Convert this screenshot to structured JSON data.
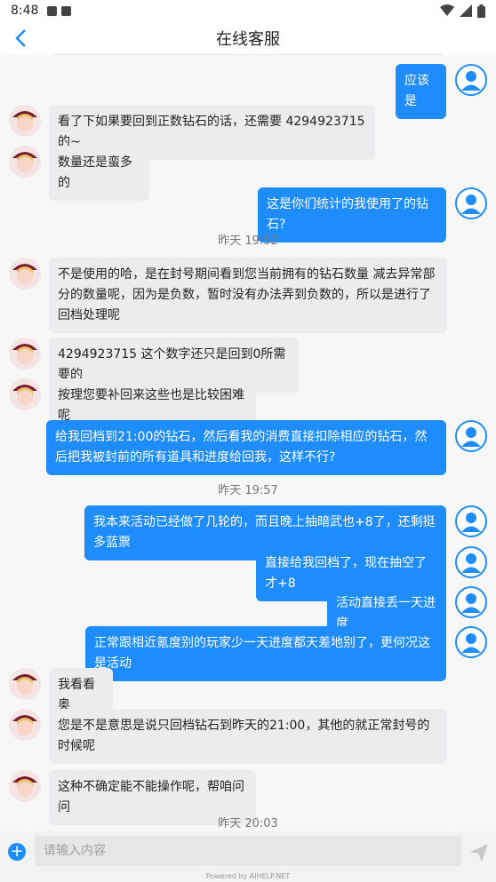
{
  "status_bar": {
    "time": "8:48",
    "icons": [
      "image-icon",
      "text-a-icon",
      "wifi-icon",
      "signal-icon",
      "battery-icon"
    ]
  },
  "header": {
    "title": "在线客服",
    "back_icon": "chevron-left-icon"
  },
  "colors": {
    "accent": "#1e8cfa",
    "bubble_left": "#ececee",
    "page_bg": "#f7f7f7"
  },
  "messages": [
    {
      "side": "right",
      "text": "应该是"
    },
    {
      "side": "left",
      "text": "看了下如果要回到正数钻石的话，还需要 4294923715 的~"
    },
    {
      "side": "left",
      "text": "数量还是蛮多的"
    },
    {
      "side": "right",
      "text": "这是你们统计的我使用了的钻石?"
    },
    {
      "type": "time",
      "text": "昨天 19:52"
    },
    {
      "side": "left",
      "text": "不是使用的哈，是在封号期间看到您当前拥有的钻石数量 减去异常部分的数量呢，因为是负数，暂时没有办法弄到负数的，所以是进行了回档处理呢"
    },
    {
      "side": "left",
      "text": "4294923715 这个数字还只是回到0所需要的"
    },
    {
      "side": "left",
      "text": "按理您要补回来这些也是比较困难呢"
    },
    {
      "side": "right",
      "text": "给我回档到21:00的钻石，然后看我的消费直接扣除相应的钻石，然后把我被封前的所有道具和进度给回我，这样不行?"
    },
    {
      "type": "time",
      "text": "昨天 19:57"
    },
    {
      "side": "right",
      "text": "我本来活动已经做了几轮的，而且晚上抽暗武也+8了，还剩挺多蓝票"
    },
    {
      "side": "right",
      "text": "直接给我回档了，现在抽空了才+8"
    },
    {
      "side": "right",
      "text": "活动直接丢一天进度"
    },
    {
      "side": "right",
      "text": "正常跟相近氪度别的玩家少一天进度都天差地别了，更何况这是活动"
    },
    {
      "side": "left",
      "text": "我看看奥"
    },
    {
      "side": "left",
      "text": "您是不是意思是说只回档钻石到昨天的21:00，其他的就正常封号的时候呢"
    },
    {
      "side": "left",
      "text": "这种不确定能不能操作呢，帮咱问问"
    },
    {
      "type": "time",
      "text": "昨天 20:03"
    }
  ],
  "composer": {
    "placeholder": "请输入内容",
    "add_icon": "plus-circle-icon",
    "send_icon": "send-icon",
    "powered_by": "Powered by AIHELP.NET"
  }
}
